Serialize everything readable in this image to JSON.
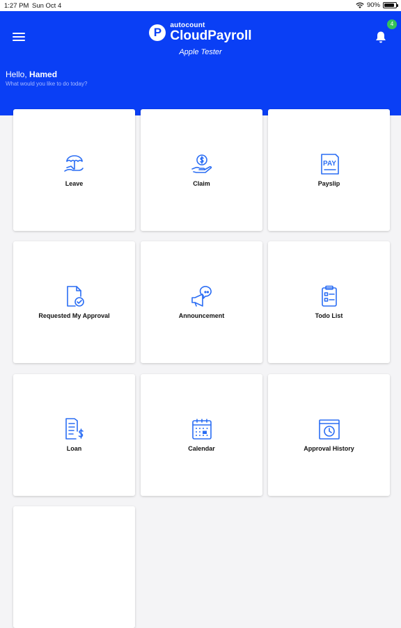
{
  "status_bar": {
    "time": "1:27 PM",
    "date": "Sun Oct 4",
    "battery": "90%",
    "battery_level": 0.9
  },
  "header": {
    "brand_sup": "autocount",
    "brand_name": "CloudPayroll",
    "company": "Apple Tester",
    "notification_count": "4",
    "greeting_prefix": "Hello,",
    "user_name": "Hamed",
    "prompt": "What would you like to do today?"
  },
  "menu": {
    "leave": "Leave",
    "claim": "Claim",
    "payslip": "Payslip",
    "requested_my_approval": "Requested My Approval",
    "announcement": "Announcement",
    "todo_list": "Todo List",
    "loan": "Loan",
    "calendar": "Calendar",
    "approval_history": "Approval History",
    "payslip_icon_text": "PAY"
  },
  "colors": {
    "brand_blue": "#0a3ff5",
    "icon_blue": "#2a6df4",
    "badge_green": "#36c25a"
  }
}
